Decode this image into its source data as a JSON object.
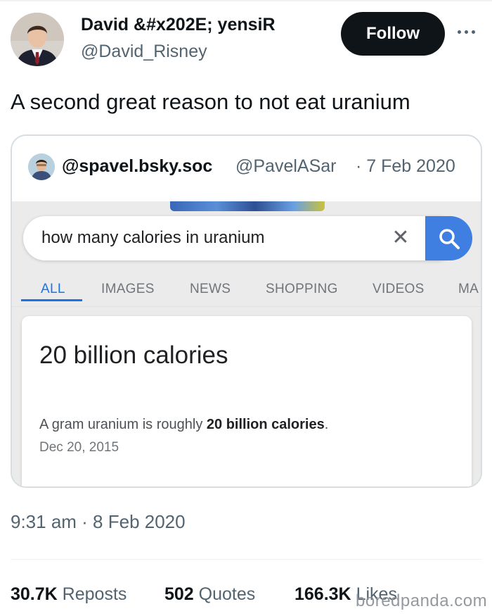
{
  "author": {
    "display_name": "David &#x202E; yensiR",
    "handle": "@David_Risney",
    "avatar_icon": "profile-photo"
  },
  "follow_label": "Follow",
  "more_icon": "more-horizontal-icon",
  "tweet_text": "A second great reason to not eat uranium",
  "quoted": {
    "display_name": "@spavel.bsky.soc",
    "handle": "@PavelASar",
    "date": "· 7 Feb 2020",
    "screenshot": {
      "search_query": "how many calories in uranium",
      "clear_icon": "close-icon",
      "search_icon": "search-icon",
      "tabs": [
        "ALL",
        "IMAGES",
        "NEWS",
        "SHOPPING",
        "VIDEOS",
        "MA"
      ],
      "active_tab": "ALL",
      "answer": "20 billion calories",
      "snippet_prefix": "A gram uranium is roughly ",
      "snippet_bold": "20 billion calories",
      "snippet_suffix": ".",
      "snippet_date": "Dec 20, 2015"
    }
  },
  "timestamp": "9:31 am · 8 Feb 2020",
  "stats": {
    "reposts_count": "30.7K",
    "reposts_label": "Reposts",
    "quotes_count": "502",
    "quotes_label": "Quotes",
    "likes_count": "166.3K",
    "likes_label": "Likes"
  },
  "watermark": "boredpanda.com",
  "colors": {
    "text": "#0f1419",
    "secondary": "#536471",
    "google_blue": "#1a73e8",
    "search_button": "#3f7fe2"
  }
}
